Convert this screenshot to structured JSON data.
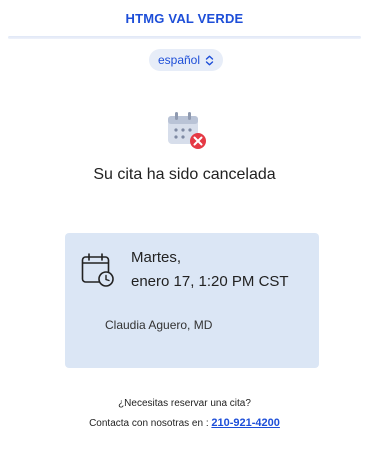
{
  "header": {
    "brand": "HTMG VAL VERDE"
  },
  "language": {
    "selected": "español",
    "icon": "chevron-updown-icon"
  },
  "status": {
    "icon": "calendar-cancel-icon",
    "message": "Su cita ha sido cancelada"
  },
  "appointment": {
    "icon": "calendar-clock-icon",
    "day": "Martes,",
    "datetime": "enero 17, 1:20 PM CST",
    "provider": "Claudia Aguero, MD"
  },
  "footer": {
    "question": "¿Necesitas reservar una cita?",
    "contact_prefix": "Contacta con nosotras en :",
    "phone": "210-921-4200"
  },
  "colors": {
    "brand": "#1d4ed8",
    "card_bg": "#dbe6f5",
    "cancel_red": "#e53945"
  }
}
